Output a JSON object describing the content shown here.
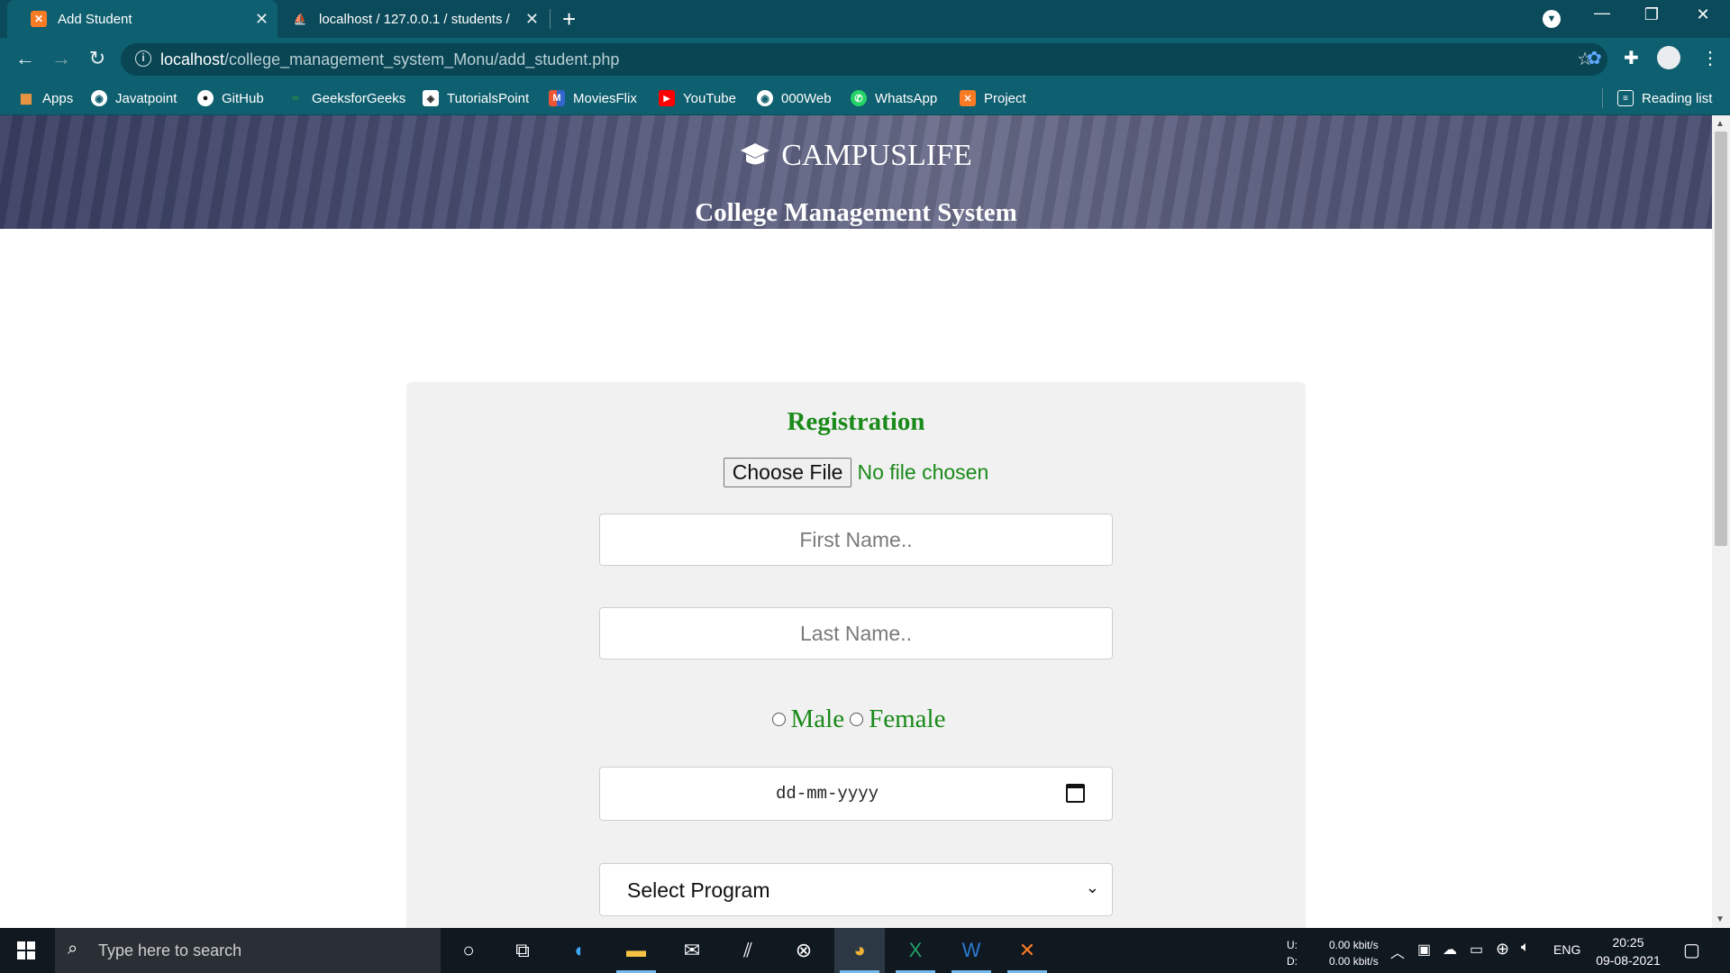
{
  "browser": {
    "tabs": [
      {
        "title": "Add Student",
        "active": true
      },
      {
        "title": "localhost / 127.0.0.1 / students / ",
        "active": false
      }
    ],
    "url_host": "localhost",
    "url_path": "/college_management_system_Monu/add_student.php",
    "bookmarks": [
      "Apps",
      "Javatpoint",
      "GitHub",
      "GeeksforGeeks",
      "TutorialsPoint",
      "MoviesFlix",
      "YouTube",
      "000Web",
      "WhatsApp",
      "Project"
    ],
    "reading_list": "Reading list"
  },
  "site": {
    "brand": "CAMPUSLIFE",
    "subtitle": "College Management System"
  },
  "form": {
    "title": "Registration",
    "file_button": "Choose File",
    "file_status": "No file chosen",
    "first_name_placeholder": "First Name..",
    "last_name_placeholder": "Last Name..",
    "gender_male": "Male",
    "gender_female": "Female",
    "dob_placeholder": "dd-mm-yyyy",
    "program_selected": "Select Program"
  },
  "taskbar": {
    "search_placeholder": "Type here to search",
    "net_up_label": "U:",
    "net_down_label": "D:",
    "net_up": "0.00 kbit/s",
    "net_down": "0.00 kbit/s",
    "language": "ENG",
    "time": "20:25",
    "date": "09-08-2021"
  }
}
